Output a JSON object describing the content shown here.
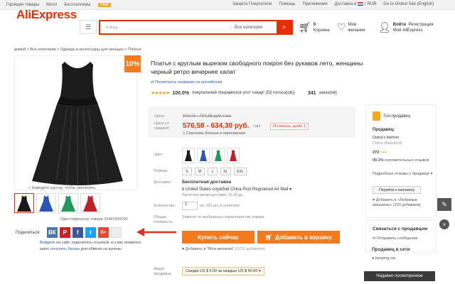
{
  "topbar": {
    "left_items": [
      "Горящие товары",
      "Молл",
      "Бестселлеры"
    ],
    "badge": "TAO",
    "right_items": [
      "Защита Покупателя",
      "Помощь",
      "Приложения"
    ],
    "delivery": "Доставка в",
    "currency": "/ RUB",
    "global": "Go to Global Site (English)"
  },
  "header": {
    "brand": "AliExpress",
    "search_placeholder": "я ищу...",
    "search_category": "Все категории",
    "cart_count": "0",
    "cart_label": "Корзина",
    "wishlist_label": "Мои желания",
    "signin": "Войти",
    "register": "Регистрация",
    "my_ali": "Мой AliExpress"
  },
  "breadcrumb": "домой > Все категории > Одежда и аксессуары для женщин > Платья",
  "gallery": {
    "badge": "10%",
    "zoom_hint": "Наведите курсор, чтобы увеличить",
    "sku_id": "Идентификатор товара 32461993036",
    "thumb_colors": [
      "#1a1a1a",
      "#2a54b8",
      "#1f9b5f",
      "#c0202a"
    ]
  },
  "share": {
    "label": "Поделиться:",
    "buttons": [
      "ВК",
      "P",
      "f",
      "t",
      "G+",
      ""
    ],
    "text_1": "Войдите",
    "text_2": " на сайт, поделитесь ссылкой, и у вас появится шанс ",
    "text_3": "получить баллы",
    "text_4": " для обмена на купоны"
  },
  "product": {
    "title": "Платья с круглым вырезом свободного покроя без рукавов лето, женщины черный ретро вечернее халат",
    "translate": "Посмотреть название на английском",
    "rating": "100.0%",
    "rating_text": "покупателей понравился этот товар! (53 голоса(ов))",
    "orders": "341",
    "orders_label": "заказ(ов)"
  },
  "price": {
    "label_price": "Цена:",
    "old": "640,71 - 704,85 руб. / шт.",
    "label_sale": "Цена со скидкой:",
    "new": "576,58 - 634,30 руб.",
    "unit": "/ шт.",
    "countdown": "Осталось: дней: 1",
    "cheaper": "Сэкономь больше в приложении"
  },
  "options": {
    "color_label": "Цвет:",
    "size_label": "Размер:",
    "sizes": [
      "S",
      "M",
      "L",
      "XL",
      "XXL"
    ],
    "shipping_label": "Доставка:",
    "shipping_free": "Бесплатная доставка",
    "shipping_to": "в",
    "shipping_via": "United States службой China Post Registered Air Mail",
    "shipping_time": "Расчетное время доставки: 15-39 дн.",
    "qty_label": "Количество:",
    "qty_value": "1",
    "qty_available": "шт. (52 шт. в наличии)",
    "total_label": "Общая стоимость:",
    "total_text": "Зависит от выбранных характеристик товара"
  },
  "actions": {
    "buy": "Купить сейчас",
    "cart": "Добавить в корзину",
    "wish": "Добавить в \"Мои желания\"",
    "wish_count": "(2312 добавили)"
  },
  "promo": {
    "label_1": "Акция",
    "label_2": "продавца:",
    "text": "Скидка US $ 5.00 за каждые US $ 40.00"
  },
  "seller": {
    "top": "Топ-продавец",
    "heading": "Продавец:",
    "name": "Diana's fashion",
    "country": "China (Mainland)",
    "score": "272",
    "positive": "99.3%",
    "positive_label": "положительных отзывов",
    "details": "Подробные отзывы о продавце",
    "store_btn": "Перейти к магазину",
    "fav": "Добавить в «Любимые магазины» (220 добавили)"
  },
  "contact": {
    "heading": "Связаться с продавцом",
    "send": "Отправить сообщение"
  },
  "network": {
    "heading": "Продавец в сети",
    "name": "baoping xia"
  },
  "recent": "Недавно посмотренное"
}
